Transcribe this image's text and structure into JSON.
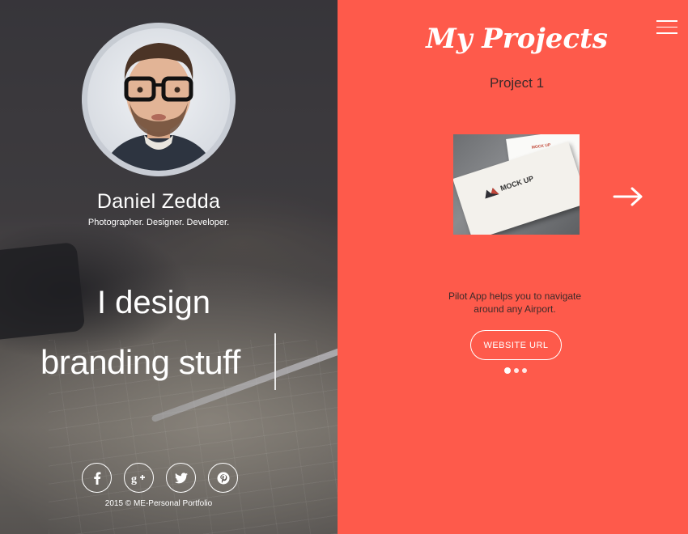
{
  "profile": {
    "name": "Daniel Zedda",
    "tagline": "Photographer. Designer. Developer."
  },
  "hero": {
    "line1": "I design",
    "line2": "branding stuff"
  },
  "social": [
    {
      "name": "facebook-icon",
      "glyph": "f"
    },
    {
      "name": "google-plus-icon",
      "glyph": "g+"
    },
    {
      "name": "twitter-icon",
      "glyph": "twitter"
    },
    {
      "name": "pinterest-icon",
      "glyph": "p"
    }
  ],
  "footer": {
    "copyright": "2015 © ME-Personal Portfolio"
  },
  "projects": {
    "title": "My Projects",
    "current_name": "Project 1",
    "description": "Pilot App helps you to navigate around any Airport.",
    "button_label": "WEBSITE URL",
    "thumb_text": "MOCK UP",
    "slide_count": 3,
    "active_slide": 1
  },
  "colors": {
    "accent": "#fe5a4b",
    "text_dark": "#3b2a2a",
    "white": "#ffffff"
  }
}
